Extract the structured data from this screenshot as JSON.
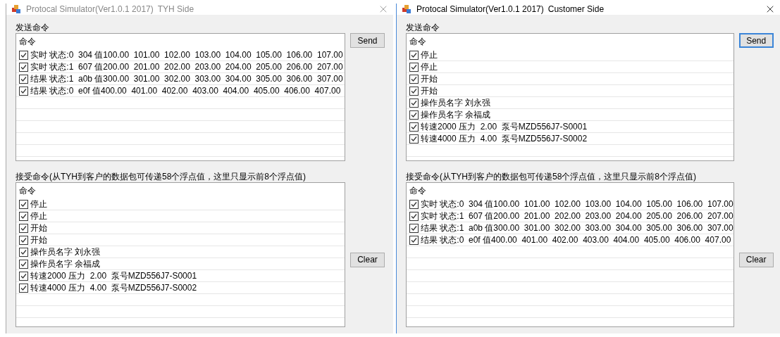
{
  "windows": [
    {
      "title": "Protocal Simulator(Ver1.0.1 2017)",
      "side": "TYH Side",
      "active": false,
      "send_label": "发送命令",
      "send_list": {
        "header": "命令",
        "rows": [
          {
            "text": "实时 状态:0  304 值100.00  101.00  102.00  103.00  104.00  105.00  106.00  107.00",
            "checked": true
          },
          {
            "text": "实时 状态:1  607 值200.00  201.00  202.00  203.00  204.00  205.00  206.00  207.00",
            "checked": true
          },
          {
            "text": "结果 状态:1  a0b 值300.00  301.00  302.00  303.00  304.00  305.00  306.00  307.00",
            "checked": true
          },
          {
            "text": "结果 状态:0  e0f 值400.00  401.00  402.00  403.00  404.00  405.00  406.00  407.00",
            "checked": true
          }
        ]
      },
      "send_button": {
        "label": "Send",
        "focused": false
      },
      "receive_label": "接受命令(从TYH到客户的数据包可传递58个浮点值，这里只显示前8个浮点值)",
      "receive_list": {
        "header": "命令",
        "rows": [
          {
            "text": "停止",
            "checked": true
          },
          {
            "text": "停止",
            "checked": true
          },
          {
            "text": "开始",
            "checked": true
          },
          {
            "text": "开始",
            "checked": true
          },
          {
            "text": "操作员名字 刘永强",
            "checked": true
          },
          {
            "text": "操作员名字 余福成",
            "checked": true
          },
          {
            "text": "转速2000 压力  2.00  泵号MZD556J7-S0001",
            "checked": true
          },
          {
            "text": "转速4000 压力  4.00  泵号MZD556J7-S0002",
            "checked": true
          }
        ]
      },
      "clear_button": {
        "label": "Clear",
        "focused": false
      }
    },
    {
      "title": "Protocal Simulator(Ver1.0.1 2017)",
      "side": "Customer Side",
      "active": true,
      "send_label": "发送命令",
      "send_list": {
        "header": "命令",
        "rows": [
          {
            "text": "停止",
            "checked": true
          },
          {
            "text": "停止",
            "checked": true
          },
          {
            "text": "开始",
            "checked": true
          },
          {
            "text": "开始",
            "checked": true
          },
          {
            "text": "操作员名字 刘永强",
            "checked": true
          },
          {
            "text": "操作员名字 余福成",
            "checked": true
          },
          {
            "text": "转速2000 压力  2.00  泵号MZD556J7-S0001",
            "checked": true
          },
          {
            "text": "转速4000 压力  4.00  泵号MZD556J7-S0002",
            "checked": true
          }
        ]
      },
      "send_button": {
        "label": "Send",
        "focused": true
      },
      "receive_label": "接受命令(从TYH到客户的数据包可传递58个浮点值，这里只显示前8个浮点值)",
      "receive_list": {
        "header": "命令",
        "rows": [
          {
            "text": "实时 状态:0  304 值100.00  101.00  102.00  103.00  104.00  105.00  106.00  107.00",
            "checked": true
          },
          {
            "text": "实时 状态:1  607 值200.00  201.00  202.00  203.00  204.00  205.00  206.00  207.00",
            "checked": true
          },
          {
            "text": "结果 状态:1  a0b 值300.00  301.00  302.00  303.00  304.00  305.00  306.00  307.00",
            "checked": true
          },
          {
            "text": "结果 状态:0  e0f 值400.00  401.00  402.00  403.00  404.00  405.00  406.00  407.00",
            "checked": true
          }
        ]
      },
      "clear_button": {
        "label": "Clear",
        "focused": false
      }
    }
  ]
}
